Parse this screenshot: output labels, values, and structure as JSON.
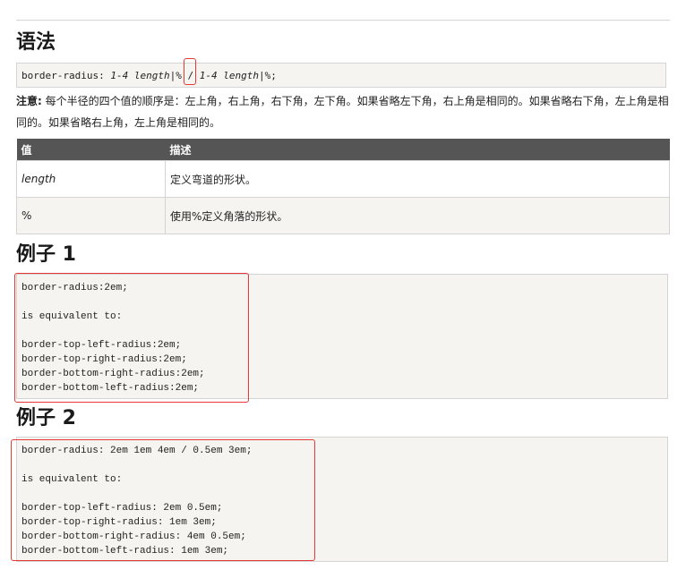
{
  "syntax": {
    "heading": "语法",
    "code": {
      "prop": "border-radius:",
      "arg1": "1-4",
      "len1": "length",
      "sep1": "|",
      "pct1": "%",
      "slash": "/",
      "arg2": "1-4",
      "len2": "length",
      "sep2": "|",
      "pct2": "%;"
    },
    "note_label": "注意:",
    "note_text": " 每个半径的四个值的顺序是：左上角，右上角，右下角，左下角。如果省略左下角，右上角是相同的。如果省略右下角，左上角是相同的。如果省略右上角，左上角是相同的。"
  },
  "values_table": {
    "headers": [
      "值",
      "描述"
    ],
    "rows": [
      {
        "value": "length",
        "desc": "定义弯道的形状。"
      },
      {
        "value": "%",
        "desc": "使用%定义角落的形状。"
      }
    ]
  },
  "example1": {
    "heading": "例子 1",
    "code": "border-radius:2em;\n\nis equivalent to:\n\nborder-top-left-radius:2em;\nborder-top-right-radius:2em;\nborder-bottom-right-radius:2em;\nborder-bottom-left-radius:2em;"
  },
  "example2": {
    "heading": "例子 2",
    "code": "border-radius: 2em 1em 4em / 0.5em 3em;\n\nis equivalent to:\n\nborder-top-left-radius: 2em 0.5em;\nborder-top-right-radius: 1em 3em;\nborder-bottom-right-radius: 4em 0.5em;\nborder-bottom-left-radius: 1em 3em;"
  },
  "colors": {
    "highlight": "#e53935",
    "code_bg": "#f6f4f0",
    "table_header_bg": "#555555"
  }
}
